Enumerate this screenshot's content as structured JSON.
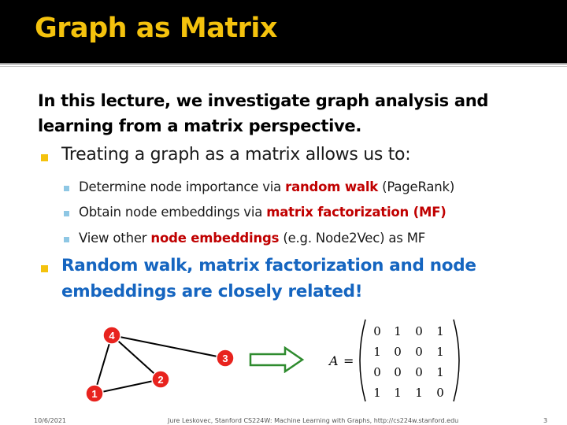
{
  "title": "Graph as Matrix",
  "intro": [
    "In this lecture, we investigate graph analysis and",
    "learning from a matrix perspective."
  ],
  "bullet1": "Treating a graph as a matrix allows us to:",
  "sub1": {
    "pre": "Determine node importance via ",
    "bold": "random walk",
    "post": " (PageRank)"
  },
  "sub2": {
    "pre": "Obtain node embeddings via ",
    "bold": "matrix factorization (MF)",
    "post": ""
  },
  "sub3": {
    "pre": "View other ",
    "bold": "node embeddings",
    "post": " (e.g. Node2Vec) as MF"
  },
  "bullet2": [
    "Random walk, matrix factorization and node",
    "embeddings are closely related!"
  ],
  "graph": {
    "nodes": [
      {
        "label": "4"
      },
      {
        "label": "3"
      },
      {
        "label": "2"
      },
      {
        "label": "1"
      }
    ]
  },
  "matrix": {
    "name": "A",
    "eq": "=",
    "rows": [
      [
        "0",
        "1",
        "0",
        "1"
      ],
      [
        "1",
        "0",
        "0",
        "1"
      ],
      [
        "0",
        "0",
        "0",
        "1"
      ],
      [
        "1",
        "1",
        "1",
        "0"
      ]
    ]
  },
  "footer": {
    "date": "10/6/2021",
    "credit": "Jure Leskovec, Stanford CS224W: Machine Learning with Graphs, http://cs224w.stanford.edu",
    "page": "3"
  },
  "colors": {
    "title": "#f4c20d",
    "header_bg": "#000000",
    "emphasis_red": "#c00000",
    "emphasis_blue": "#1565c0",
    "node_fill": "#e8231e",
    "arrow": "#2e8b2e"
  }
}
